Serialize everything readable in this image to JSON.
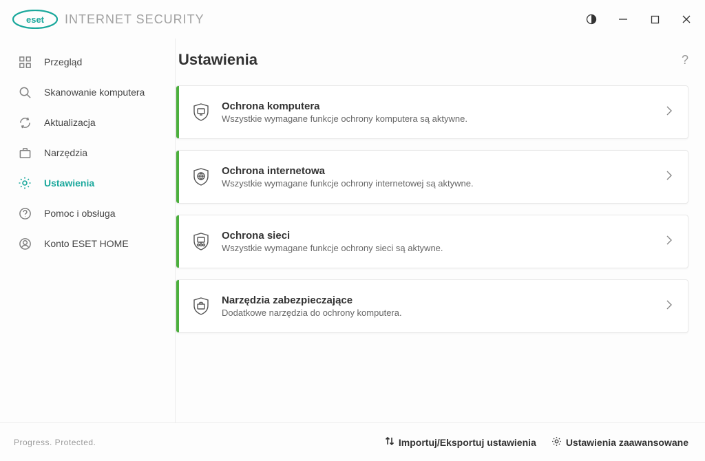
{
  "brand": {
    "name": "ESET",
    "product": "INTERNET SECURITY"
  },
  "sidebar": {
    "items": [
      {
        "label": "Przegląd"
      },
      {
        "label": "Skanowanie komputera"
      },
      {
        "label": "Aktualizacja"
      },
      {
        "label": "Narzędzia"
      },
      {
        "label": "Ustawienia"
      },
      {
        "label": "Pomoc i obsługa"
      },
      {
        "label": "Konto ESET HOME"
      }
    ]
  },
  "page": {
    "title": "Ustawienia",
    "help": "?"
  },
  "cards": [
    {
      "title": "Ochrona komputera",
      "subtitle": "Wszystkie wymagane funkcje ochrony komputera są aktywne."
    },
    {
      "title": "Ochrona internetowa",
      "subtitle": "Wszystkie wymagane funkcje ochrony internetowej są aktywne."
    },
    {
      "title": "Ochrona sieci",
      "subtitle": "Wszystkie wymagane funkcje ochrony sieci są aktywne."
    },
    {
      "title": "Narzędzia zabezpieczające",
      "subtitle": "Dodatkowe narzędzia do ochrony komputera."
    }
  ],
  "footer": {
    "tagline": "Progress. Protected.",
    "import_export": "Importuj/Eksportuj ustawienia",
    "advanced": "Ustawienia zaawansowane"
  }
}
